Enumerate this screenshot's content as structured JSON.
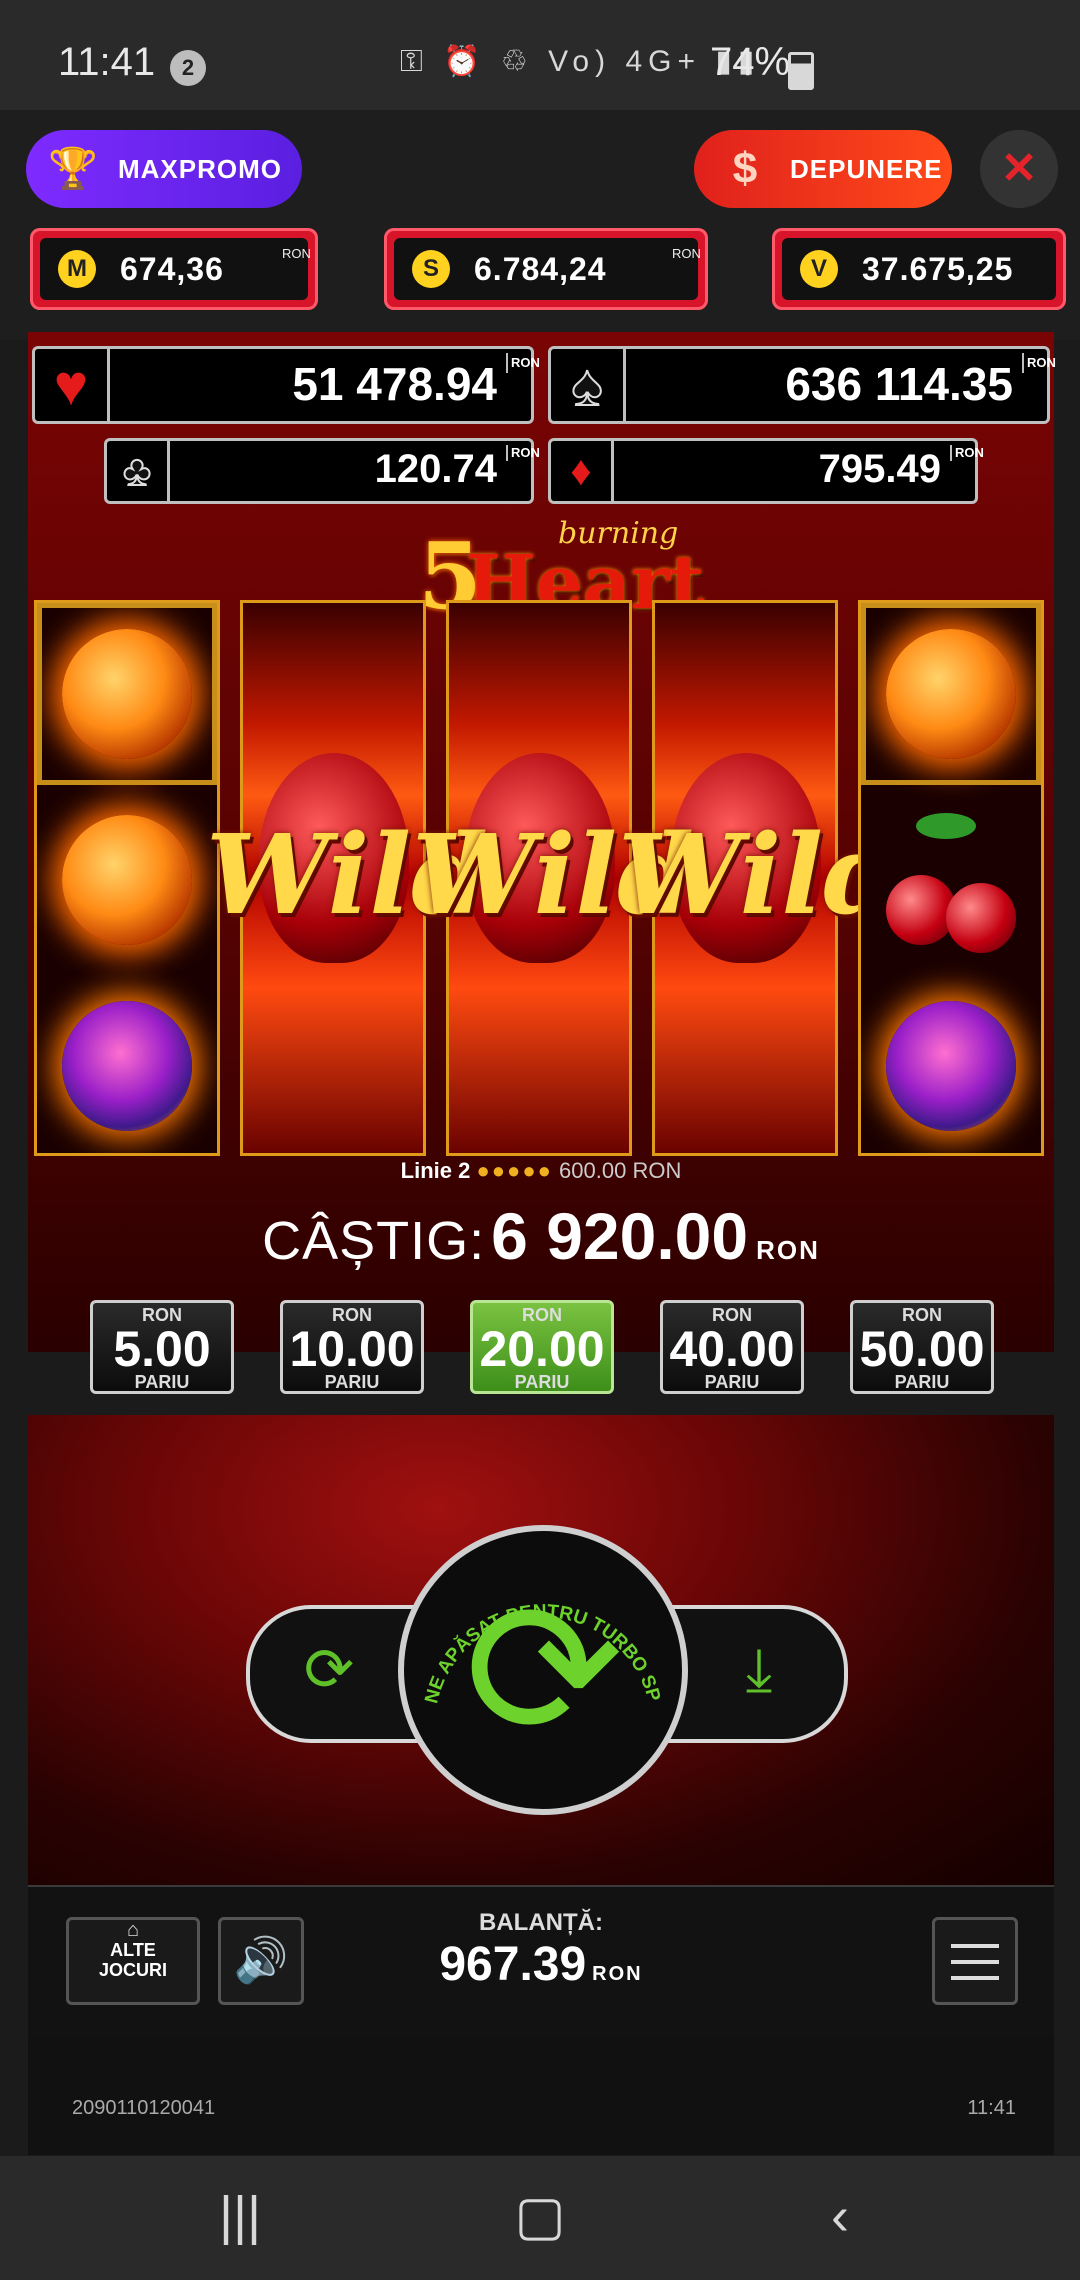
{
  "status_bar": {
    "time": "11:41",
    "notif_count": "2",
    "icons": "⚿ ⏰ ♲ Vo) 4G+ ▮▮",
    "network_label": "LTE1",
    "battery": "74%"
  },
  "top_bar": {
    "promo_label": "MAXPROMO",
    "deposit_label": "DEPUNERE",
    "close_label": "✕",
    "jackpots": [
      {
        "coin": "M",
        "value": "674,36",
        "currency": "RON"
      },
      {
        "coin": "S",
        "value": "6.784,24",
        "currency": "RON"
      },
      {
        "coin": "V",
        "value": "37.675,25",
        "currency": "RON"
      }
    ]
  },
  "game": {
    "jackpots": {
      "heart": "51 478.94",
      "spade": "636 114.35",
      "club": "120.74",
      "diamond": "795.49",
      "currency": "RON"
    },
    "logo": {
      "five": "5",
      "burning": "burning",
      "heart": "Heart"
    },
    "wild_label": "Wild",
    "win_line": {
      "label": "Linie 2",
      "coins": "●●●●●",
      "amount": "600.00",
      "currency": "RON"
    },
    "win": {
      "label": "CÂȘTIG:",
      "value": "6 920.00",
      "currency": "RON"
    },
    "bets": [
      {
        "currency": "RON",
        "amount": "5.00",
        "label": "PARIU",
        "active": false
      },
      {
        "currency": "RON",
        "amount": "10.00",
        "label": "PARIU",
        "active": false
      },
      {
        "currency": "RON",
        "amount": "20.00",
        "label": "PARIU",
        "active": true
      },
      {
        "currency": "RON",
        "amount": "40.00",
        "label": "PARIU",
        "active": false
      },
      {
        "currency": "RON",
        "amount": "50.00",
        "label": "PARIU",
        "active": false
      }
    ],
    "spin_hint": "ȚINE APĂSAT PENTRU TURBO SPIN"
  },
  "bottom_bar": {
    "other_games_line1": "ALTE",
    "other_games_line2": "JOCURI",
    "balance_label": "BALANȚĂ:",
    "balance_value": "967.39",
    "balance_currency": "RON"
  },
  "footer": {
    "session_id": "2090110120041",
    "time": "11:41"
  },
  "colors": {
    "accent_green": "#6dd22c",
    "promo_purple": "#7e2bff",
    "deposit_red": "#e0211c",
    "jackpot_red": "#d7142a"
  }
}
